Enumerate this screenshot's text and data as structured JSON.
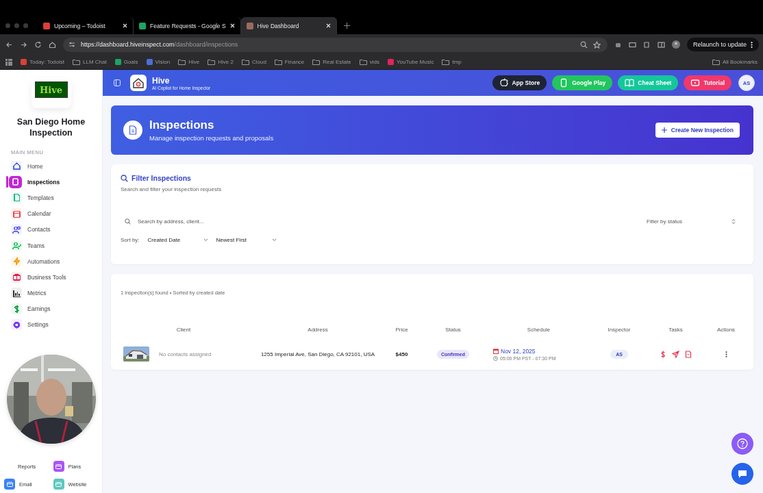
{
  "browser": {
    "tabs": [
      {
        "title": "Upcoming – Todoist",
        "selected": false,
        "color": "#db4035"
      },
      {
        "title": "Feature Requests - Google S",
        "selected": false,
        "color": "#1ea362"
      },
      {
        "title": "Hive Dashboard",
        "selected": true,
        "color": "#9b6b5a"
      }
    ],
    "url_host": "https://dashboard.hiveinspect.com",
    "url_path": "/dashboard/inspections",
    "relaunch": "Relaunch to update",
    "bookmarks": [
      {
        "label": "Today: Todoist",
        "kind": "app",
        "color": "#db4035"
      },
      {
        "label": "LLM Chat",
        "kind": "folder"
      },
      {
        "label": "Goals",
        "kind": "app",
        "color": "#1ea362"
      },
      {
        "label": "Vision",
        "kind": "app",
        "color": "#4a6fd8"
      },
      {
        "label": "Hive",
        "kind": "folder"
      },
      {
        "label": "Hive 2",
        "kind": "folder"
      },
      {
        "label": "Cloud",
        "kind": "folder"
      },
      {
        "label": "Finance",
        "kind": "folder"
      },
      {
        "label": "Real Estate",
        "kind": "folder"
      },
      {
        "label": "vids",
        "kind": "folder"
      },
      {
        "label": "YouTube Music",
        "kind": "app",
        "color": "#e0245e"
      },
      {
        "label": "tmp",
        "kind": "folder"
      }
    ],
    "all_bookmarks": "All Bookmarks"
  },
  "sidebar": {
    "logo_text": "Hive",
    "company": "San Diego Home Inspection",
    "section": "MAIN MENU",
    "items": [
      {
        "label": "Home",
        "selected": false,
        "color": "#4f6be0"
      },
      {
        "label": "Inspections",
        "selected": true,
        "color": "#c026d3"
      },
      {
        "label": "Templates",
        "selected": false,
        "color": "#10b981"
      },
      {
        "label": "Calendar",
        "selected": false,
        "color": "#ef4444"
      },
      {
        "label": "Contacts",
        "selected": false,
        "color": "#6366f1"
      },
      {
        "label": "Teams",
        "selected": false,
        "color": "#22c55e"
      },
      {
        "label": "Automations",
        "selected": false,
        "color": "#f59e0b"
      },
      {
        "label": "Business Tools",
        "selected": false,
        "color": "#e11d48"
      },
      {
        "label": "Metrics",
        "selected": false,
        "color": "#333333"
      },
      {
        "label": "Earnings",
        "selected": false,
        "color": "#16a34a"
      },
      {
        "label": "Settings",
        "selected": false,
        "color": "#7c3aed"
      }
    ],
    "shortcuts": [
      {
        "label": "Reports"
      },
      {
        "label": "Plans",
        "color": "#a855f7"
      },
      {
        "label": "Email",
        "color": "#3b82f6"
      },
      {
        "label": "Website",
        "color": "#5cc8c0"
      }
    ]
  },
  "header": {
    "app_name": "Hive",
    "tagline": "AI Copilot for Home Inspector",
    "buttons": [
      {
        "label": "App Store",
        "color": "#1f2433"
      },
      {
        "label": "Google Play",
        "color": "#22c55e"
      },
      {
        "label": "Cheat Sheet",
        "color": "#14c79a"
      },
      {
        "label": "Tutorial",
        "color": "#f0386b"
      }
    ],
    "avatar": "AS"
  },
  "banner": {
    "title": "Inspections",
    "subtitle": "Manage inspection requests and proposals",
    "button": "Create New Inspection"
  },
  "filter": {
    "title": "Filter Inspections",
    "subtitle": "Search and filter your inspection requests",
    "search_placeholder": "Search by address, client...",
    "status_placeholder": "Filter by status",
    "sort_label": "Sort by:",
    "sort_field": "Created Date",
    "sort_order": "Newest First"
  },
  "results": {
    "summary": "1 inspection(s) found • Sorted by created date",
    "columns": [
      "Client",
      "Address",
      "Price",
      "Status",
      "Schedule",
      "Inspector",
      "Tasks",
      "Actions"
    ],
    "rows": [
      {
        "client": "No contacts assigned",
        "address": "1255 Imperial Ave, San Diego, CA 92101, USA",
        "price": "$450",
        "status": "Confirmed",
        "date": "Nov 12, 2025",
        "time": "05:00 PM PST - 07:30 PM",
        "inspector": "AS"
      }
    ]
  }
}
